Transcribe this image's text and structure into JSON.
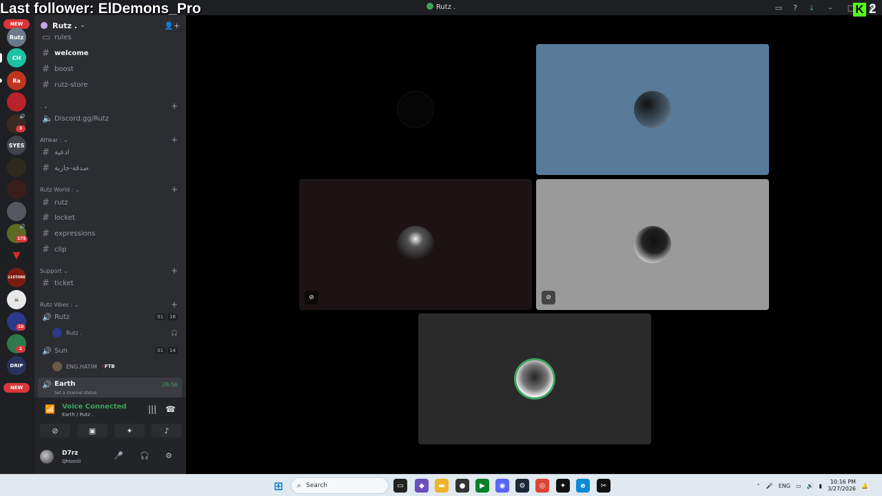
{
  "overlay": {
    "follower_text": "Last follower: ElDemons_Pro",
    "kick_logo": "K",
    "kick_count": "2"
  },
  "window": {
    "title": "Rutz .",
    "icons": [
      "screen-share-icon",
      "help-icon",
      "download-icon",
      "minimize-icon",
      "maximize-icon",
      "close-icon"
    ]
  },
  "rail": {
    "new_label": "NEW",
    "badges": [
      "3",
      "175",
      "10",
      "2"
    ],
    "server_labels": [
      "Rutz",
      "CH",
      "Ra",
      "SYES",
      "DRIP",
      "21STORE"
    ]
  },
  "server": {
    "name": "Rutz .",
    "chevron": "⌄"
  },
  "channels": {
    "top": [
      "rules",
      "welcome",
      "boost",
      "rutz-store"
    ],
    "dot_category": {
      "name": ". ⌄",
      "items": [
        "Discord.gg/Rutz"
      ]
    },
    "athkar": {
      "name": "Athkar : ⌄",
      "items": [
        "ادعية",
        "صدقة-جارية"
      ]
    },
    "rutz_world": {
      "name": "Rutz World : ⌄",
      "items": [
        "rutz",
        "locket",
        "expressions",
        "clip"
      ]
    },
    "support": {
      "name": "Support ⌄",
      "items": [
        "ticket"
      ]
    },
    "rutz_vibes": {
      "name": "Rutz Vibes : ⌄"
    }
  },
  "voice_channels": {
    "rutz": {
      "name": "Rutz",
      "count_a": "01",
      "count_b": "16",
      "user": "Rutz ."
    },
    "sun": {
      "name": "Sun",
      "count_a": "01",
      "count_b": "14",
      "user": "ENG.HATIM",
      "tag": "FTB"
    },
    "earth": {
      "name": "Earth",
      "timer": "28:56",
      "status_placeholder": "Set a channel status"
    }
  },
  "voice_panel": {
    "status": "Voice Connected",
    "location": "Earth / Rutz ."
  },
  "user_panel": {
    "name": "D7rz",
    "status": "Qhtoniii"
  },
  "taskbar": {
    "search_placeholder": "Search",
    "lang": "ENG",
    "time": "10:16 PM",
    "date": "3/27/2026"
  },
  "colors": {
    "accent_green": "#3ba55d",
    "tile_blue": "#577b98",
    "tile_gray": "#9a9a9a",
    "tile_dark": "#2a2a2a",
    "tile_brown": "#1c1414",
    "kick_green": "#53fc18"
  }
}
